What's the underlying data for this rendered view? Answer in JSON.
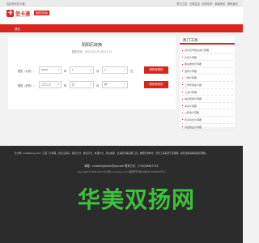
{
  "topbar": {
    "welcome": "欢迎来到信卡通！",
    "links": [
      "学习工具",
      "日常生活",
      "科学化学",
      "新闻资讯",
      "联系我们"
    ]
  },
  "header": {
    "logo_mark": "卡",
    "logo_text": "信卡通",
    "logo_sub": "luckytong.com",
    "logo_tag": "阴阳历转换"
  },
  "nav": {
    "item": "首页"
  },
  "tool": {
    "title": "阴阳历转换",
    "current_time": "更新时间：2023-03-29 20:47:23",
    "solar_row": {
      "label": "阳历（公历）：",
      "year": "2023",
      "year_unit": "年",
      "month": "1",
      "month_unit": "月",
      "day": "1",
      "day_unit": "日",
      "button": "阳历转阴历"
    },
    "lunar_row": {
      "label": "阴历（农历）：",
      "year": "二〇二三",
      "year_unit": "年",
      "month": "正",
      "month_unit": "月",
      "day": "初一",
      "button": "阴历转阳历"
    }
  },
  "sidebar": {
    "title": "热门工具",
    "items": [
      "身份证号码生成计算器",
      "房贷计算器",
      "税后收益计算器",
      "退休计算器",
      "个税计算器",
      "工作年限总计器",
      "工资计算器",
      "信贷费用计算器",
      "车贷计算器",
      "公积金计算器",
      "利息综合计算器",
      "基金收益计算器"
    ]
  },
  "footer": {
    "description": "信卡通（luckytong.com）汇集了计算器、新生儿取名、起名打分、姓名打分、成语大全、周公解梦、生肖配对等实用工具，数据仅供参考，部分工具来源于互联网，如有侵权请联系我们删除。",
    "email": "邮箱：shuzhongbeian@qq.com 联系方式：(+81)56847745",
    "copyright": "Copyright©2009-2023 信卡通 luckytong.com 版权所有 闽ICP备2021028282号-1"
  },
  "watermark": "华美双扬网"
}
